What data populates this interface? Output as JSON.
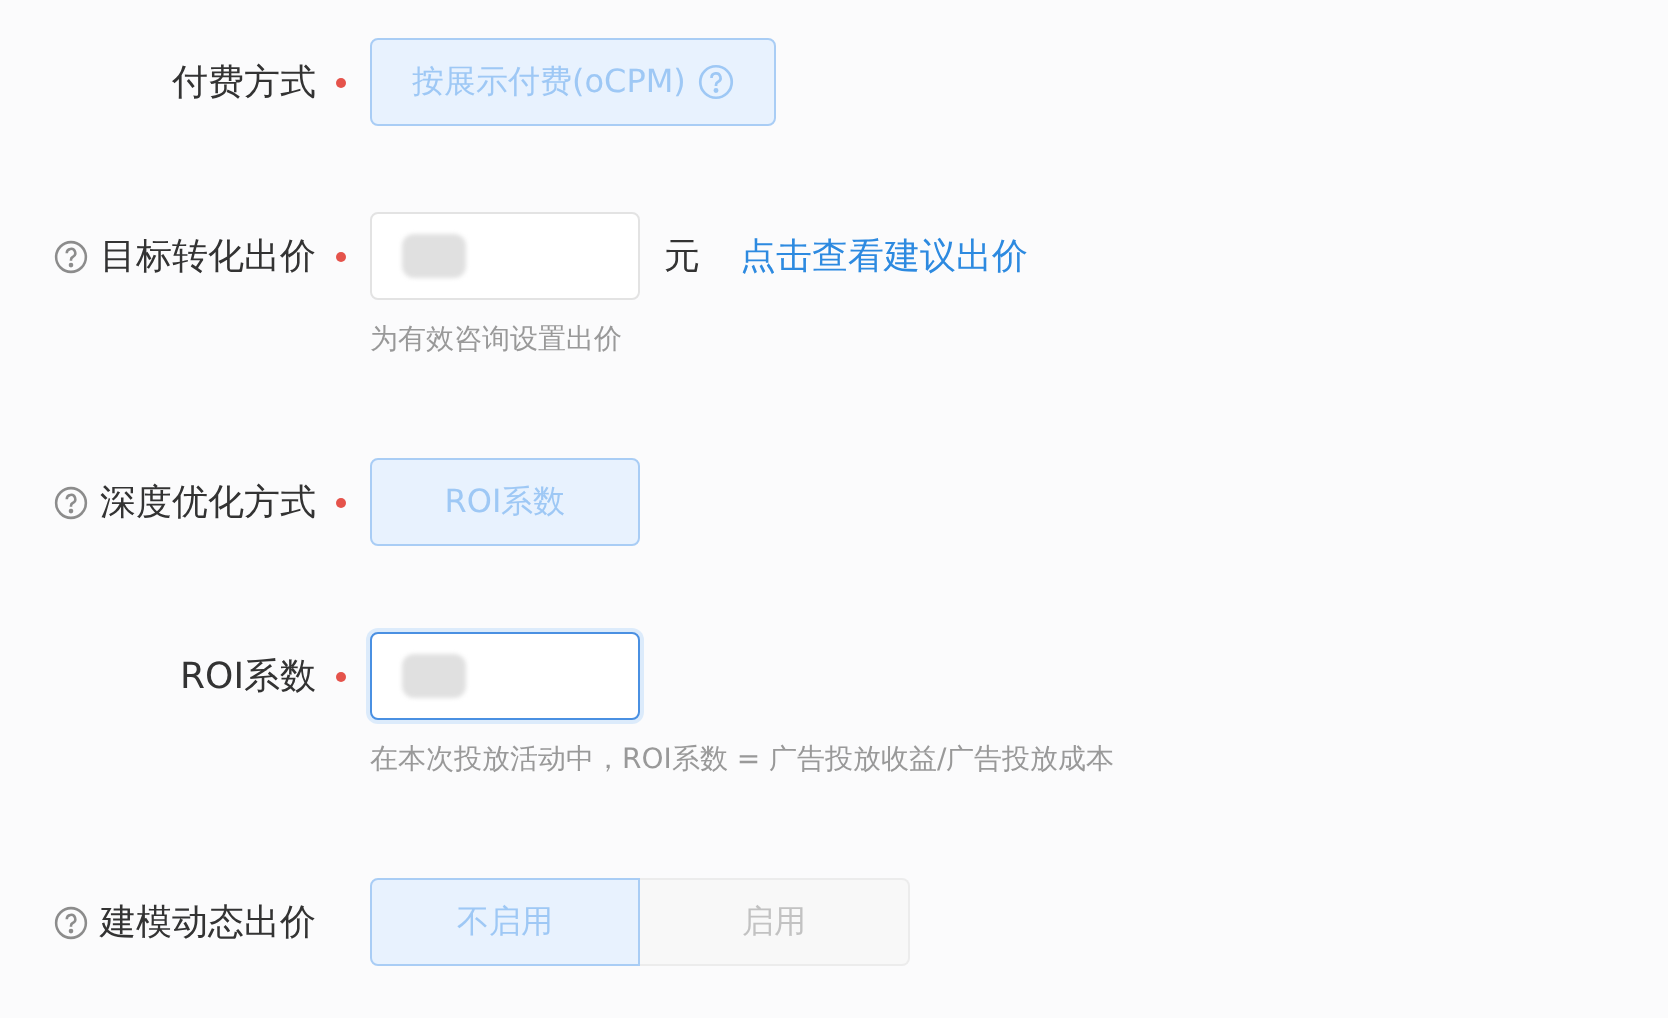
{
  "form": [
    {
      "kind": "segmented",
      "label": "付费方式",
      "help": false,
      "required": true,
      "options": [
        {
          "label": "按展示付费(oCPM)",
          "help": true,
          "selected": true
        }
      ]
    },
    {
      "kind": "input",
      "label": "目标转化出价",
      "help": true,
      "required": true,
      "focused": false,
      "unit": "元",
      "link": "点击查看建议出价",
      "hint": "为有效咨询设置出价"
    },
    {
      "kind": "segmented",
      "label": "深度优化方式",
      "help": true,
      "required": true,
      "options": [
        {
          "label": "ROI系数",
          "help": false,
          "selected": true
        }
      ]
    },
    {
      "kind": "input",
      "label": "ROI系数",
      "help": false,
      "required": true,
      "focused": true,
      "hint": "在本次投放活动中，ROI系数 = 广告投放收益/广告投放成本"
    },
    {
      "kind": "segmented",
      "label": "建模动态出价",
      "help": true,
      "required": false,
      "options": [
        {
          "label": "不启用",
          "help": false,
          "selected": true
        },
        {
          "label": "启用",
          "help": false,
          "selected": false
        }
      ]
    }
  ]
}
